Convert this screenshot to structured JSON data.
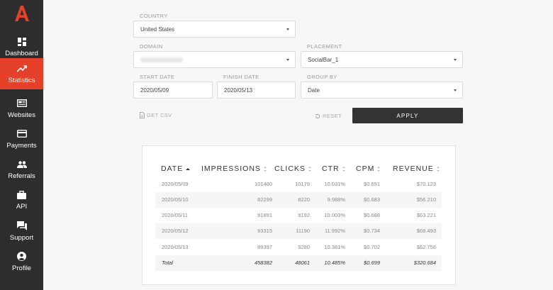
{
  "brand": {
    "logo_letter": "A",
    "accent": "#e4402a"
  },
  "sidebar": {
    "items": [
      {
        "label": "Dashboard",
        "icon": "dashboard-icon",
        "active": false
      },
      {
        "label": "Statistics",
        "icon": "trending-up-icon",
        "active": true
      },
      {
        "label": "Websites",
        "icon": "newspaper-icon",
        "active": false
      },
      {
        "label": "Payments",
        "icon": "credit-card-icon",
        "active": false
      },
      {
        "label": "Referrals",
        "icon": "people-icon",
        "active": false
      },
      {
        "label": "API",
        "icon": "briefcase-icon",
        "active": false
      },
      {
        "label": "Support",
        "icon": "chat-icon",
        "active": false
      },
      {
        "label": "Profile",
        "icon": "user-icon",
        "active": false
      }
    ]
  },
  "filters": {
    "country": {
      "label": "COUNTRY",
      "value": "United States"
    },
    "domain": {
      "label": "DOMAIN",
      "value": ""
    },
    "placement": {
      "label": "PLACEMENT",
      "value": "SocialBar_1"
    },
    "start_date": {
      "label": "START DATE",
      "value": "2020/05/09"
    },
    "finish_date": {
      "label": "FINISH DATE",
      "value": "2020/05/13"
    },
    "group_by": {
      "label": "GROUP BY",
      "value": "Date"
    }
  },
  "actions": {
    "get_csv": "GET CSV",
    "reset": "RESET",
    "apply": "APPLY"
  },
  "table": {
    "headers": [
      "DATE",
      "IMPRESSIONS",
      "CLICKS",
      "CTR",
      "CPM",
      "REVENUE"
    ],
    "rows": [
      [
        "2020/05/09",
        "101480",
        "10179",
        "10.031%",
        "$0.691",
        "$70.123"
      ],
      [
        "2020/05/10",
        "82299",
        "8220",
        "9.988%",
        "$0.683",
        "$56.210"
      ],
      [
        "2020/05/11",
        "91891",
        "9192",
        "10.003%",
        "$0.688",
        "$63.221"
      ],
      [
        "2020/05/12",
        "93315",
        "11190",
        "11.992%",
        "$0.734",
        "$68.493"
      ],
      [
        "2020/05/13",
        "89397",
        "9280",
        "10.381%",
        "$0.702",
        "$62.756"
      ]
    ],
    "total": [
      "Total",
      "458382",
      "48061",
      "10.485%",
      "$0.699",
      "$320.684"
    ]
  }
}
